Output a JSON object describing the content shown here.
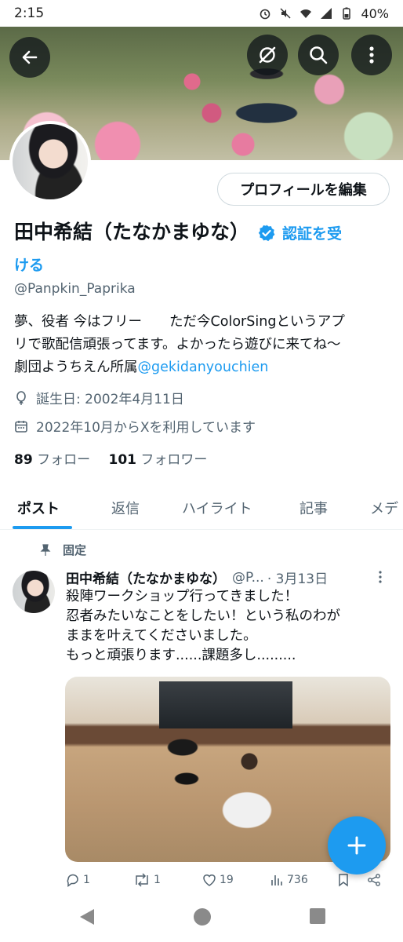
{
  "status_bar": {
    "time": "2:15",
    "battery": "40%"
  },
  "header": {
    "back_icon": "arrow-left-icon",
    "grok_icon": "grok-icon",
    "search_icon": "search-icon",
    "more_icon": "more-vert-icon"
  },
  "profile": {
    "edit_button": "プロフィールを編集",
    "display_name": "田中希結（たなかまゆな）",
    "verify_link_line1": "認証を受",
    "verify_link_line2": "ける",
    "handle": "@Panpkin_Paprika",
    "bio_line1": "夢、役者 今はフリー　　ただ今ColorSingというアプ",
    "bio_line2": "リで歌配信頑張ってます。よかったら遊びに来てね〜",
    "bio_line3_prefix": "劇団ようちえん所属",
    "bio_mention": "@gekidanyouchien",
    "birthday": "誕生日: 2002年4月11日",
    "joined": "2022年10月からXを利用しています",
    "following_count": "89",
    "following_label": "フォロー",
    "followers_count": "101",
    "followers_label": "フォロワー"
  },
  "tabs": [
    {
      "label": "ポスト"
    },
    {
      "label": "返信"
    },
    {
      "label": "ハイライト"
    },
    {
      "label": "記事"
    },
    {
      "label": "メデ"
    }
  ],
  "pinned_label": "固定",
  "tweet": {
    "name": "田中希結（たなかまゆな）",
    "handle": "@P...",
    "date": "· 3月13日",
    "text_line1": "殺陣ワークショップ行ってきました！",
    "text_line2": "忍者みたいなことをしたい！という私のわが",
    "text_line3": "ままを叶えてくださいました。",
    "text_line4": "もっと頑張ります......課題多し.........",
    "replies": "1",
    "reposts": "1",
    "likes": "19",
    "views": "736"
  },
  "colors": {
    "accent": "#1d9bf0",
    "text": "#0f1419",
    "secondary": "#536471"
  }
}
